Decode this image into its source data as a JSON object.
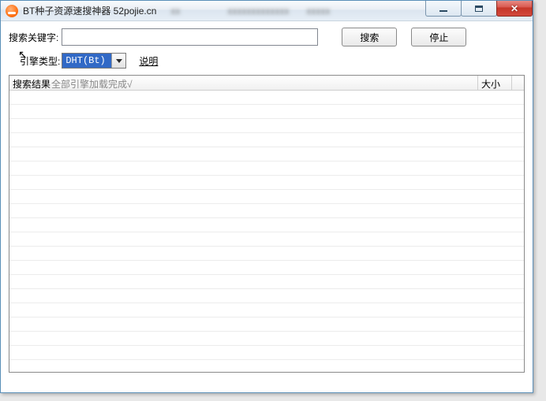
{
  "titlebar": {
    "title": "BT种子资源速搜神器 52pojie.cn"
  },
  "toolbar": {
    "keyword_label": "搜索关键字:",
    "keyword_value": "",
    "search_label": "搜索",
    "stop_label": "停止",
    "engine_label": "引擎类型:",
    "engine_selected": "DHT(Bt)",
    "explain_label": "说明"
  },
  "grid": {
    "col_result": "搜索结果",
    "col_result_status": "全部引擎加载完成√",
    "col_size": "大小"
  }
}
